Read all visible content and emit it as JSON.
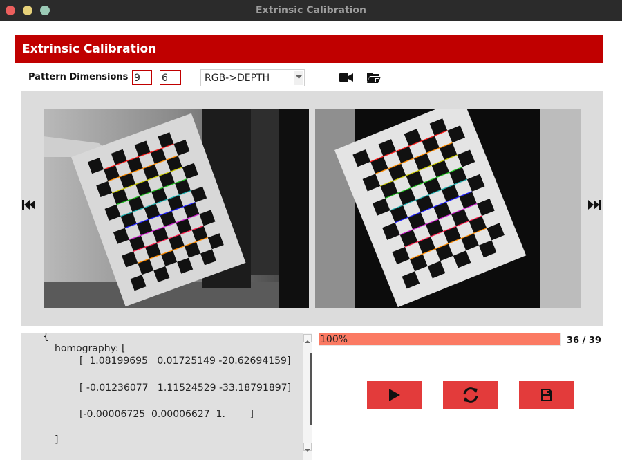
{
  "window": {
    "title": "Extrinsic Calibration"
  },
  "header": {
    "title": "Extrinsic Calibration"
  },
  "controls": {
    "pattern_label": "Pattern Dimensions",
    "pattern_cols": "9",
    "pattern_rows": "6",
    "mode_selected": "RGB->DEPTH",
    "camera_icon": "video-camera-icon",
    "folder_icon": "folder-open-icon"
  },
  "navigation": {
    "prev_icon": "skip-back-icon",
    "next_icon": "skip-forward-icon"
  },
  "output_text": {
    "lines": [
      "{",
      "homography: [",
      "[  1.08199695   0.01725149 -20.62694159]",
      "[ -0.01236077   1.11524529 -33.18791897]",
      "[-0.00006725  0.00006627  1.        ]",
      "]"
    ]
  },
  "progress": {
    "percent_label": "100%",
    "fraction": 1.0,
    "count": "36 / 39"
  },
  "actions": {
    "play_icon": "play-icon",
    "reset_icon": "refresh-icon",
    "save_icon": "save-icon"
  },
  "colors": {
    "accent": "#c00000",
    "button": "#e33b3b",
    "progress_fill": "#fb7a63",
    "panel": "#dcdcdc"
  }
}
